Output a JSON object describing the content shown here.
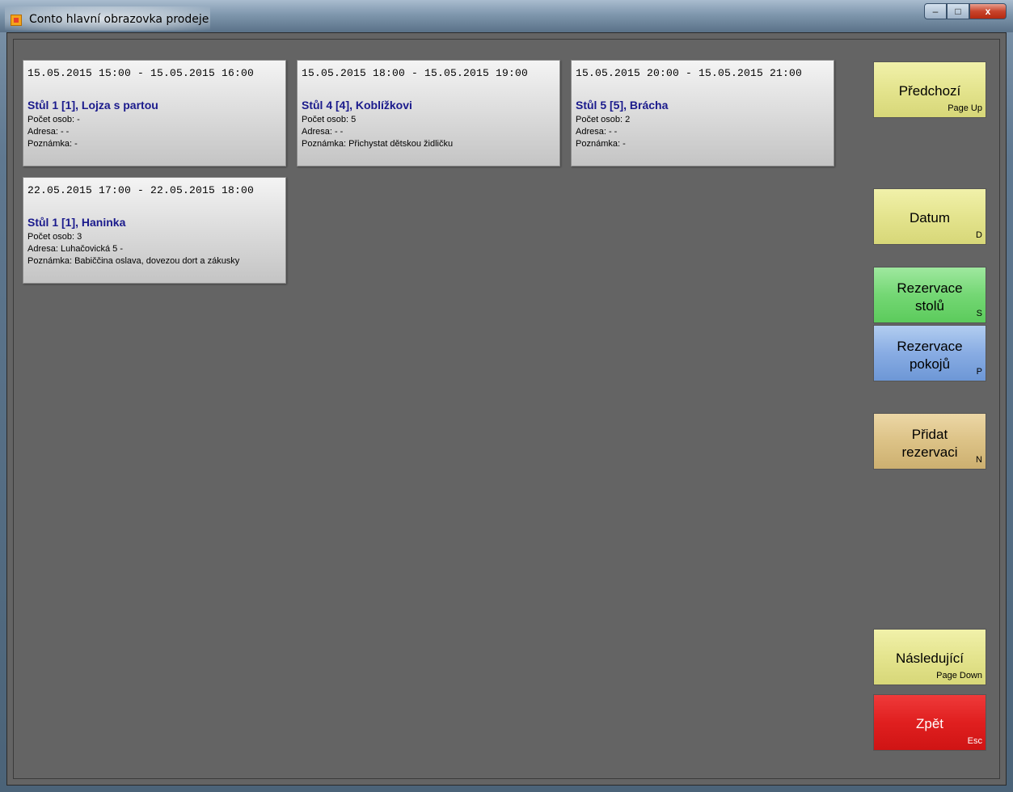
{
  "window": {
    "title": "Conto hlavní obrazovka prodeje",
    "controls": {
      "minimize": "–",
      "maximize": "□",
      "close": "x"
    }
  },
  "reservations": [
    {
      "time": "15.05.2015 15:00 - 15.05.2015 16:00",
      "title": "Stůl 1 [1], Lojza s partou",
      "persons": "Počet osob: -",
      "address": "Adresa: - -",
      "note": "Poznámka: -"
    },
    {
      "time": "15.05.2015 18:00 - 15.05.2015 19:00",
      "title": "Stůl 4 [4], Koblížkovi",
      "persons": "Počet osob: 5",
      "address": "Adresa: - -",
      "note": "Poznámka: Přichystat dětskou židličku"
    },
    {
      "time": "15.05.2015 20:00 - 15.05.2015 21:00",
      "title": "Stůl 5 [5], Brácha",
      "persons": "Počet osob: 2",
      "address": "Adresa: - -",
      "note": "Poznámka: -"
    },
    {
      "time": "22.05.2015 17:00 - 22.05.2015 18:00",
      "title": "Stůl 1 [1], Haninka",
      "persons": "Počet osob: 3",
      "address": "Adresa: Luhačovická 5 -",
      "note": "Poznámka: Babiččina oslava, dovezou dort a zákusky"
    }
  ],
  "sidebar": {
    "previous": {
      "line1": "Předchozí",
      "key": "Page Up"
    },
    "date": {
      "line1": "Datum",
      "key": "D"
    },
    "table_reservations": {
      "line1": "Rezervace",
      "line2": "stolů",
      "key": "S"
    },
    "room_reservations": {
      "line1": "Rezervace",
      "line2": "pokojů",
      "key": "P"
    },
    "add_reservation": {
      "line1": "Přidat",
      "line2": "rezervaci",
      "key": "N"
    },
    "next": {
      "line1": "Následující",
      "key": "Page Down"
    },
    "back": {
      "line1": "Zpět",
      "key": "Esc"
    }
  }
}
